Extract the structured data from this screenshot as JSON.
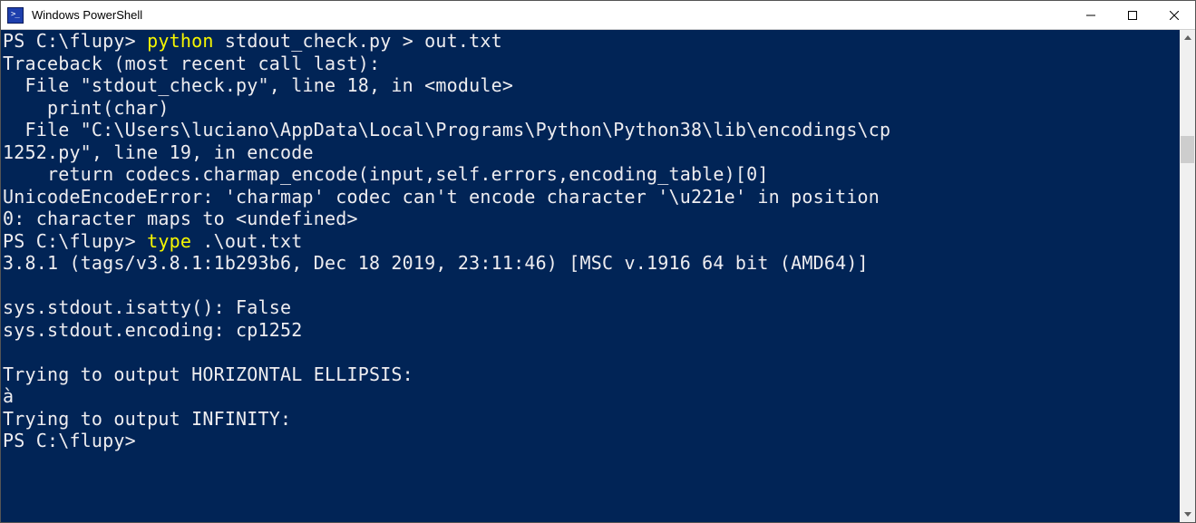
{
  "window": {
    "title": "Windows PowerShell"
  },
  "icons": {
    "app": "powershell-icon",
    "minimize": "minimize-icon",
    "maximize": "maximize-icon",
    "close": "close-icon",
    "scroll_up": "scroll-up-icon",
    "scroll_down": "scroll-down-icon"
  },
  "terminal": {
    "lines": [
      {
        "segments": [
          {
            "cls": "prompt",
            "text": "PS C:\\flupy> "
          },
          {
            "cls": "cmd-yellow",
            "text": "python"
          },
          {
            "cls": "cmd-white",
            "text": " stdout_check.py > out.txt"
          }
        ]
      },
      {
        "segments": [
          {
            "cls": "cmd-white",
            "text": "Traceback (most recent call last):"
          }
        ]
      },
      {
        "segments": [
          {
            "cls": "cmd-white",
            "text": "  File \"stdout_check.py\", line 18, in <module>"
          }
        ]
      },
      {
        "segments": [
          {
            "cls": "cmd-white",
            "text": "    print(char)"
          }
        ]
      },
      {
        "segments": [
          {
            "cls": "cmd-white",
            "text": "  File \"C:\\Users\\luciano\\AppData\\Local\\Programs\\Python\\Python38\\lib\\encodings\\cp"
          }
        ]
      },
      {
        "segments": [
          {
            "cls": "cmd-white",
            "text": "1252.py\", line 19, in encode"
          }
        ]
      },
      {
        "segments": [
          {
            "cls": "cmd-white",
            "text": "    return codecs.charmap_encode(input,self.errors,encoding_table)[0]"
          }
        ]
      },
      {
        "segments": [
          {
            "cls": "cmd-white",
            "text": "UnicodeEncodeError: 'charmap' codec can't encode character '\\u221e' in position "
          }
        ]
      },
      {
        "segments": [
          {
            "cls": "cmd-white",
            "text": "0: character maps to <undefined>"
          }
        ]
      },
      {
        "segments": [
          {
            "cls": "prompt",
            "text": "PS C:\\flupy> "
          },
          {
            "cls": "cmd-yellow",
            "text": "type "
          },
          {
            "cls": "cmd-white",
            "text": ".\\out.txt"
          }
        ]
      },
      {
        "segments": [
          {
            "cls": "cmd-white",
            "text": "3.8.1 (tags/v3.8.1:1b293b6, Dec 18 2019, 23:11:46) [MSC v.1916 64 bit (AMD64)]"
          }
        ]
      },
      {
        "segments": [
          {
            "cls": "cmd-white",
            "text": ""
          }
        ]
      },
      {
        "segments": [
          {
            "cls": "cmd-white",
            "text": "sys.stdout.isatty(): False"
          }
        ]
      },
      {
        "segments": [
          {
            "cls": "cmd-white",
            "text": "sys.stdout.encoding: cp1252"
          }
        ]
      },
      {
        "segments": [
          {
            "cls": "cmd-white",
            "text": ""
          }
        ]
      },
      {
        "segments": [
          {
            "cls": "cmd-white",
            "text": "Trying to output HORIZONTAL ELLIPSIS:"
          }
        ]
      },
      {
        "segments": [
          {
            "cls": "cmd-white",
            "text": "à"
          }
        ]
      },
      {
        "segments": [
          {
            "cls": "cmd-white",
            "text": "Trying to output INFINITY:"
          }
        ]
      },
      {
        "segments": [
          {
            "cls": "prompt",
            "text": "PS C:\\flupy>"
          }
        ]
      }
    ]
  }
}
